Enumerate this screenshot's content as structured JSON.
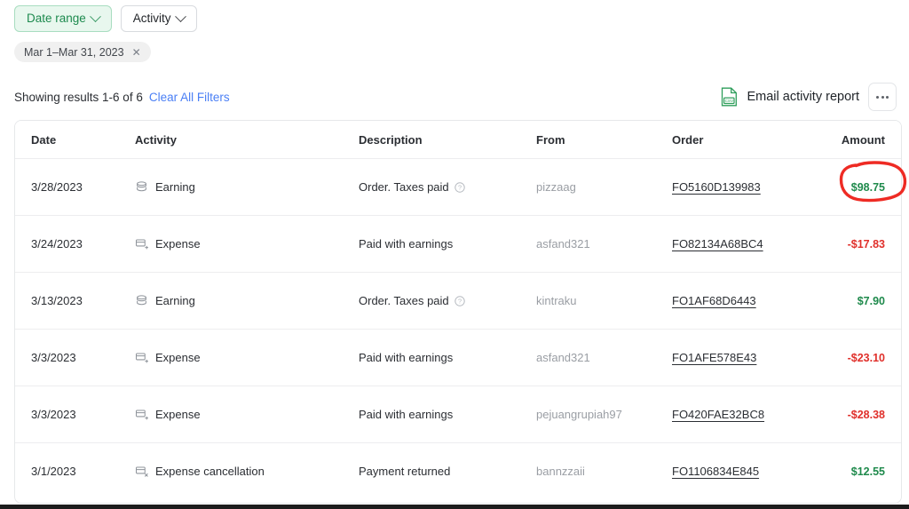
{
  "filters": {
    "date_range_label": "Date range",
    "activity_label": "Activity",
    "chips": [
      {
        "label": "Mar 1–Mar 31, 2023",
        "remove_icon": "close-icon"
      }
    ],
    "accent_green": "#1d8a4e",
    "chip_bg": "#f0f0f0"
  },
  "results": {
    "showing_text": "Showing results 1-6 of 6",
    "clear_label": "Clear All Filters",
    "clear_color": "#4a7ff5",
    "email_report_label": "Email activity report",
    "csv_icon": "csv-file-icon",
    "csv_icon_color": "#2e9e5b",
    "more_icon": "ellipsis-icon"
  },
  "table": {
    "columns": [
      "Date",
      "Activity",
      "Description",
      "From",
      "Order",
      "Amount"
    ],
    "rows": [
      {
        "date": "3/28/2023",
        "activity": "Earning",
        "activity_icon": "coins-stack-icon",
        "description": "Order. Taxes paid",
        "has_help_icon": true,
        "from": "pizzaag",
        "order": "FO5160D139983",
        "amount": "$98.75",
        "amount_sign": "pos",
        "annotated": true
      },
      {
        "date": "3/24/2023",
        "activity": "Expense",
        "activity_icon": "card-outgoing-icon",
        "description": "Paid with earnings",
        "has_help_icon": false,
        "from": "asfand321",
        "order": "FO82134A68BC4",
        "amount": "-$17.83",
        "amount_sign": "neg",
        "annotated": false
      },
      {
        "date": "3/13/2023",
        "activity": "Earning",
        "activity_icon": "coins-stack-icon",
        "description": "Order. Taxes paid",
        "has_help_icon": true,
        "from": "kintraku",
        "order": "FO1AF68D6443",
        "amount": "$7.90",
        "amount_sign": "pos",
        "annotated": false
      },
      {
        "date": "3/3/2023",
        "activity": "Expense",
        "activity_icon": "card-outgoing-icon",
        "description": "Paid with earnings",
        "has_help_icon": false,
        "from": "asfand321",
        "order": "FO1AFE578E43",
        "amount": "-$23.10",
        "amount_sign": "neg",
        "annotated": false
      },
      {
        "date": "3/3/2023",
        "activity": "Expense",
        "activity_icon": "card-outgoing-icon",
        "description": "Paid with earnings",
        "has_help_icon": false,
        "from": "pejuangrupiah97",
        "order": "FO420FAE32BC8",
        "amount": "-$28.38",
        "amount_sign": "neg",
        "annotated": false
      },
      {
        "date": "3/1/2023",
        "activity": "Expense cancellation",
        "activity_icon": "card-cancelled-icon",
        "description": "Payment returned",
        "has_help_icon": false,
        "from": "bannzzaii",
        "order": "FO1106834E845",
        "amount": "$12.55",
        "amount_sign": "pos",
        "annotated": false
      }
    ]
  },
  "annotation": {
    "shape": "hand-drawn-circle",
    "color": "#ee2b24",
    "target": "$98.75"
  },
  "colors": {
    "positive": "#1f8a4c",
    "negative": "#e0302b",
    "text": "#2b2e33",
    "muted": "#9a9ea4",
    "border": "#e6e8ea"
  }
}
